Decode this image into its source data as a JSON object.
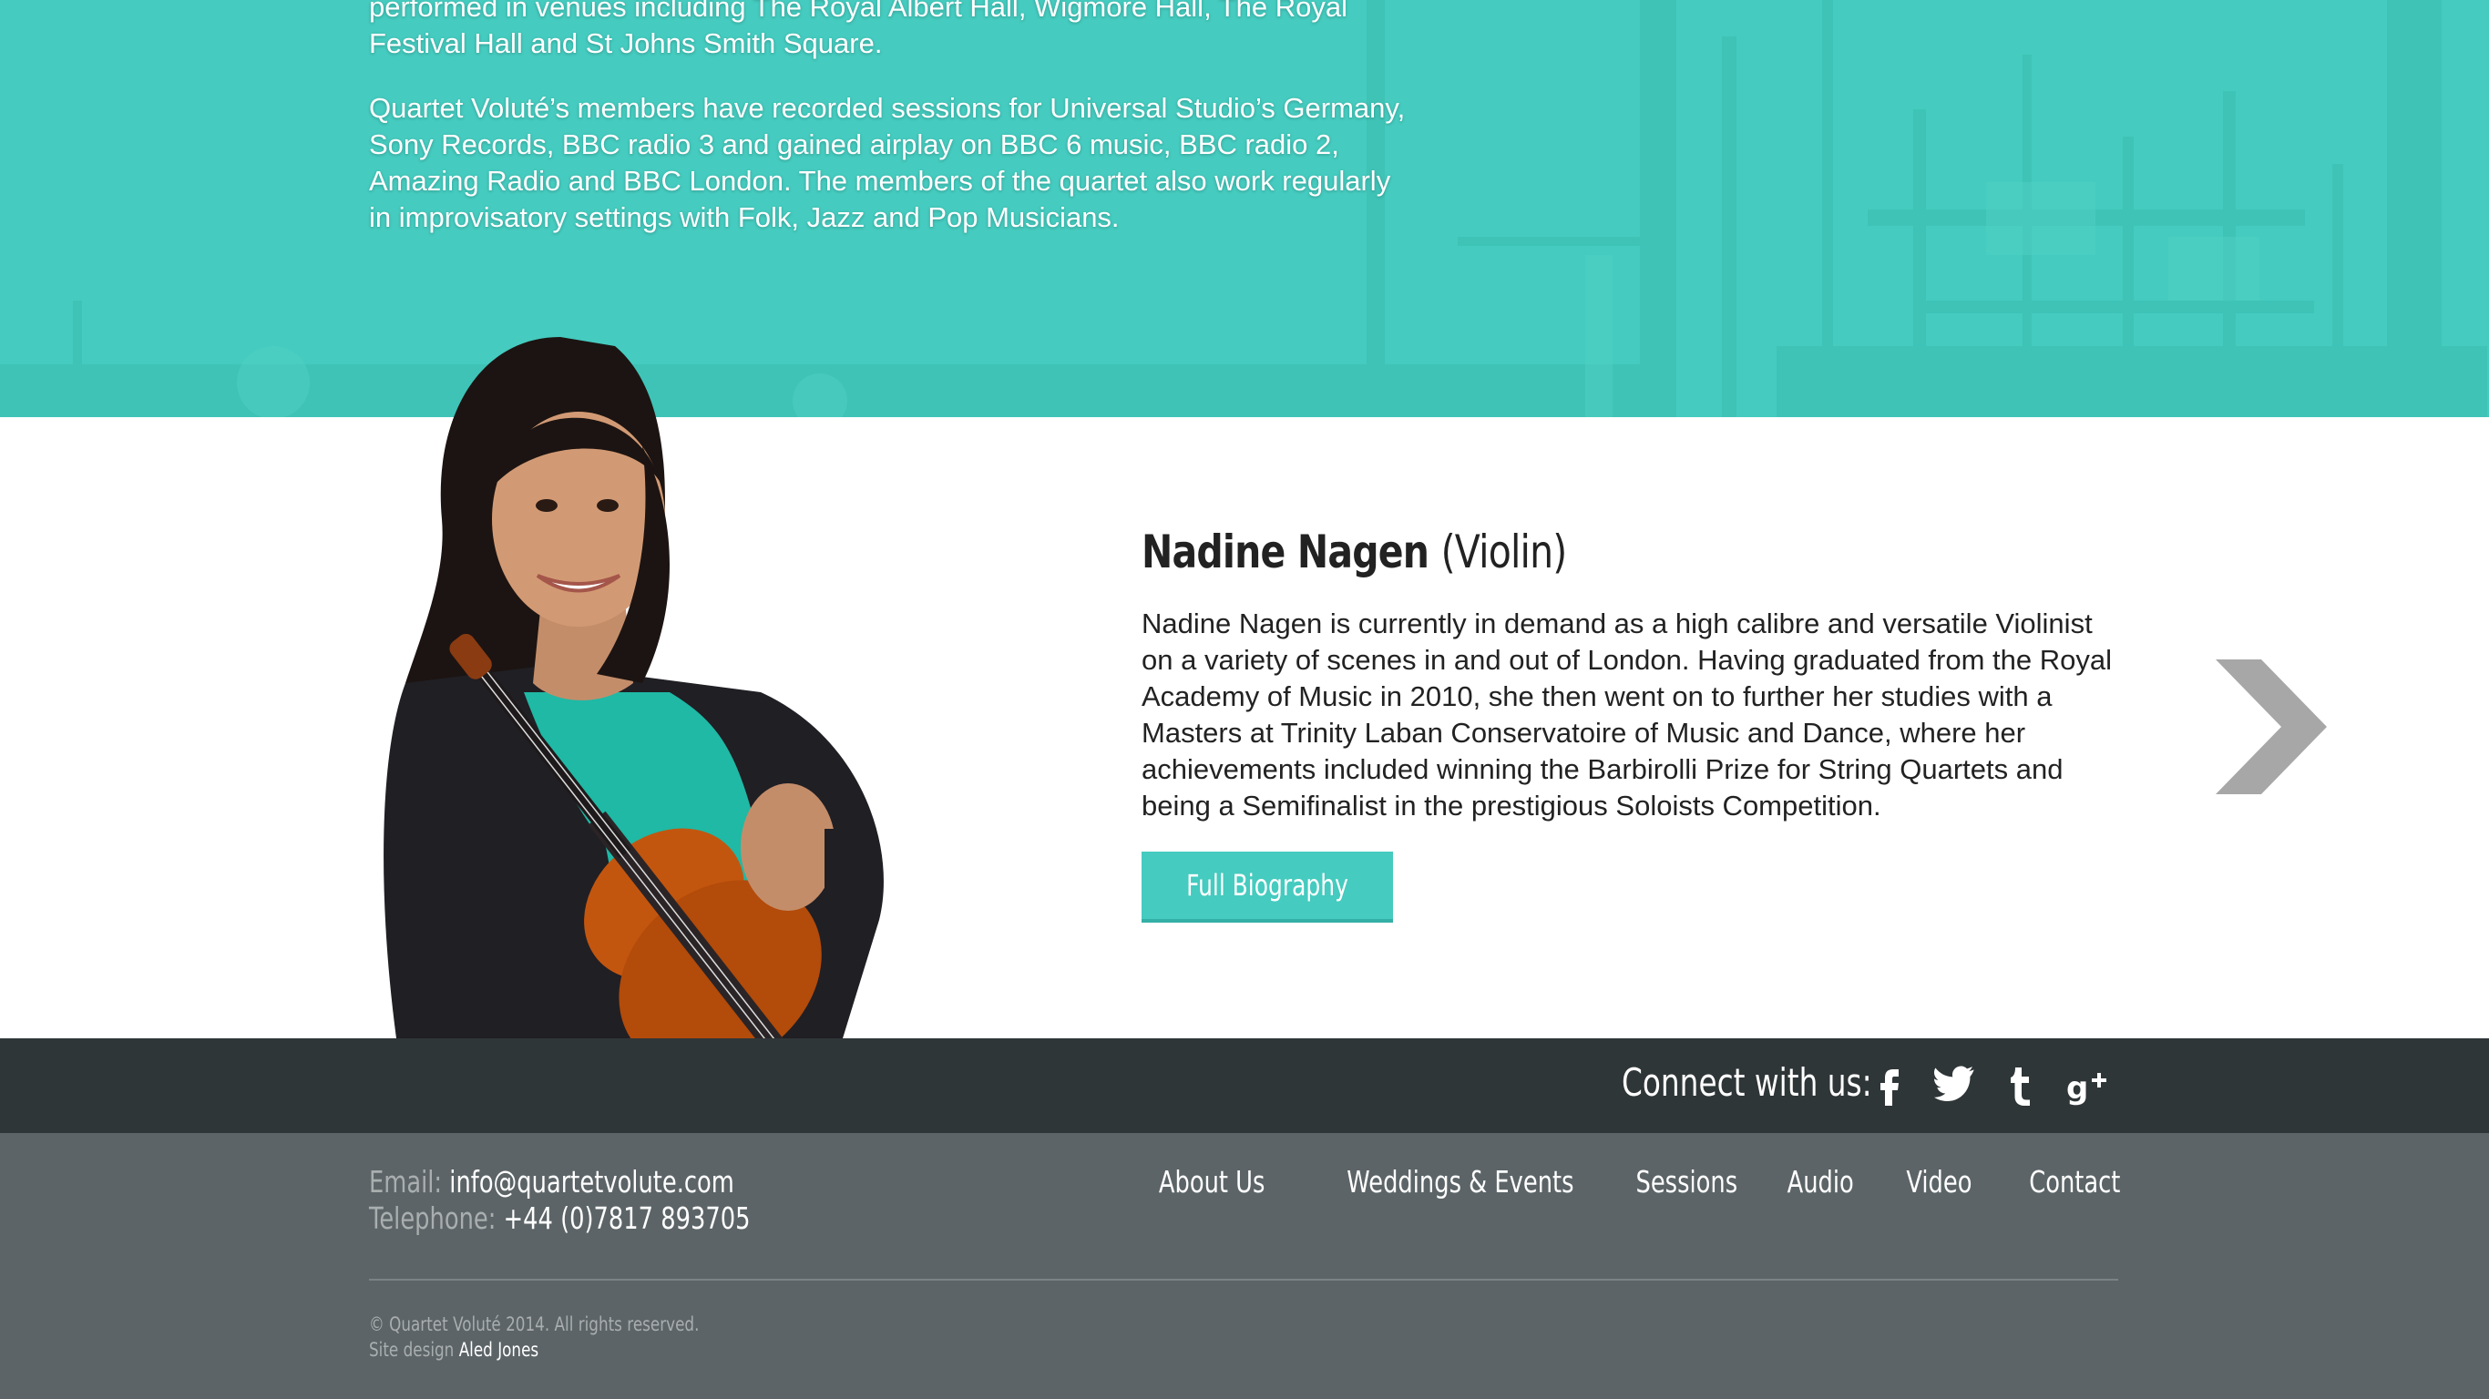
{
  "hero": {
    "paragraph_1": "performed in venues including The Royal Albert Hall, Wigmore Hall, The Royal Festival Hall and St Johns Smith Square.",
    "paragraph_2": "Quartet Voluté’s members have recorded sessions for Universal Studio’s Germany, Sony Records, BBC radio 3 and gained airplay on BBC 6 music, BBC radio 2, Amazing Radio and BBC London. The members of the quartet also work regularly in improvisatory settings with Folk, Jazz and Pop Musicians."
  },
  "member": {
    "name": "Nadine Nagen",
    "role": "(Violin)",
    "bio": "Nadine Nagen is currently in demand as a high calibre and versatile Violinist on a variety of scenes in and out of London. Having graduated from the Royal Academy of Music in 2010, she then went on to further her studies with a Masters at Trinity Laban Conservatoire of Music and Dance, where her achievements included winning the Barbirolli Prize for String Quartets and being a Semifinalist in the prestigious Soloists Competition.",
    "button_label": "Full Biography"
  },
  "connect": {
    "label": "Connect with us:",
    "icons": [
      "facebook-icon",
      "twitter-icon",
      "tumblr-icon",
      "google-plus-icon"
    ]
  },
  "footer": {
    "email_label": "Email:",
    "email": "info@quartetvolute.com",
    "phone_label": "Telephone:",
    "phone": "+44 (0)7817 893705",
    "nav": [
      "About Us",
      "Weddings & Events",
      "Sessions",
      "Audio",
      "Video",
      "Contact"
    ],
    "copyright": "© Quartet Voluté 2014. All rights reserved.",
    "design_label": "Site design",
    "designer": "Aled Jones"
  },
  "colors": {
    "teal": "#45cbbf",
    "dark_strip": "#2f3638",
    "footer_bg": "#5c6467"
  }
}
